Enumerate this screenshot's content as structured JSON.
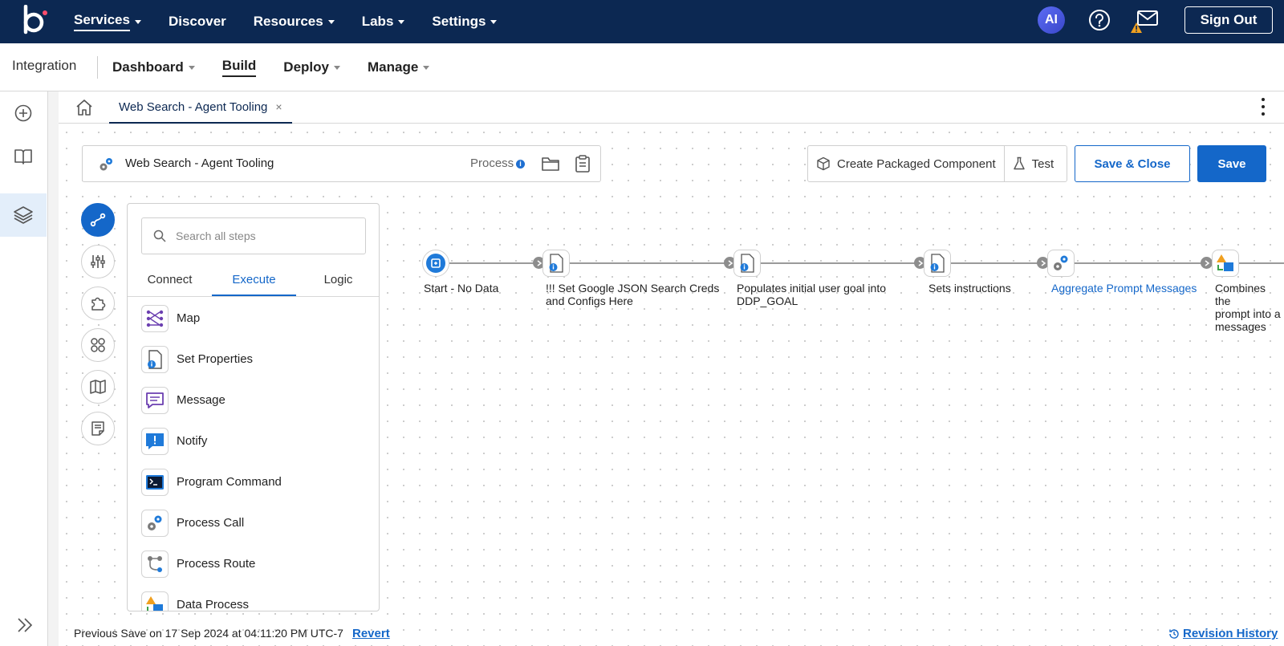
{
  "topnav": {
    "items": [
      {
        "label": "Services"
      },
      {
        "label": "Discover"
      },
      {
        "label": "Resources"
      },
      {
        "label": "Labs"
      },
      {
        "label": "Settings"
      }
    ],
    "ai_badge": "AI",
    "signout_label": "Sign Out"
  },
  "subnav": {
    "app": "Integration",
    "items": [
      {
        "label": "Dashboard"
      },
      {
        "label": "Build"
      },
      {
        "label": "Deploy"
      },
      {
        "label": "Manage"
      }
    ]
  },
  "tabs": {
    "active_label": "Web Search - Agent Tooling",
    "close": "×"
  },
  "process": {
    "name": "Web Search - Agent Tooling",
    "type": "Process",
    "info": "i"
  },
  "actions": {
    "create_packaged": "Create Packaged Component",
    "test": "Test",
    "save_close": "Save & Close",
    "save": "Save"
  },
  "palette": {
    "search_placeholder": "Search all steps",
    "tabs": [
      {
        "label": "Connect"
      },
      {
        "label": "Execute"
      },
      {
        "label": "Logic"
      }
    ],
    "items": [
      {
        "label": "Map",
        "icon": "map-icon"
      },
      {
        "label": "Set Properties",
        "icon": "set-properties-icon"
      },
      {
        "label": "Message",
        "icon": "message-icon"
      },
      {
        "label": "Notify",
        "icon": "notify-icon"
      },
      {
        "label": "Program Command",
        "icon": "program-command-icon"
      },
      {
        "label": "Process Call",
        "icon": "process-call-icon"
      },
      {
        "label": "Process Route",
        "icon": "process-route-icon"
      },
      {
        "label": "Data Process",
        "icon": "data-process-icon"
      }
    ]
  },
  "flow": {
    "steps": [
      {
        "label": "Start - No Data"
      },
      {
        "label1": "!!! Set Google JSON Search Creds",
        "label2": "and Configs Here"
      },
      {
        "label1": "Populates initial user goal into",
        "label2": "DDP_GOAL"
      },
      {
        "label": "Sets instructions"
      },
      {
        "label": "Aggregate Prompt Messages"
      },
      {
        "label1": "Combines the",
        "label2": "prompt into a",
        "label3": "messages"
      }
    ]
  },
  "footer": {
    "previous_save": "Previous Save on 17 Sep 2024 at 04:11:20 PM UTC-7",
    "revert": "Revert",
    "revision_history": "Revision History"
  },
  "colors": {
    "topbar": "#0c2852",
    "accent": "#1467c9"
  }
}
